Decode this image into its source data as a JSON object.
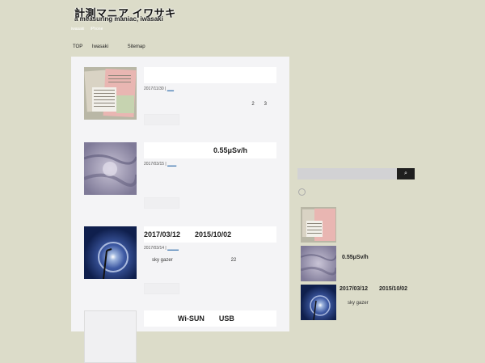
{
  "header": {
    "title": "計測マニア イワサキ",
    "subtitle": "a measuring maniac, iwasaki",
    "breadcrumb": [
      "iwasaki",
      "iPhone"
    ]
  },
  "nav": {
    "items": [
      "TOP",
      "Iwasaki",
      "Sitemap"
    ]
  },
  "posts": [
    {
      "title": "",
      "date": "2017/11/30",
      "meta_link": "___",
      "excerpt": "2　　3"
    },
    {
      "title": "0.55μSv/h",
      "date": "2017/03/15",
      "meta_link": "____",
      "excerpt": ""
    },
    {
      "title": "2017/03/12　　2015/10/02",
      "date": "2017/03/14",
      "meta_link": "_____",
      "excerpt": "sky gazer　　　　　　　　　　　　22"
    },
    {
      "title": "Wi-SUN　　USB",
      "date": "",
      "meta_link": "",
      "excerpt": ""
    }
  ],
  "sidebar": {
    "search_button": "⌕",
    "recent": [
      {
        "title": "",
        "sub": ""
      },
      {
        "title": "0.55μSv/h",
        "sub": ""
      },
      {
        "title": "2017/03/12　　2015/10/02",
        "sub": "sky gazer"
      }
    ]
  },
  "colors": {
    "background": "#dcdcc9",
    "content_bg": "#f4f4f6",
    "link": "#4a7fb5"
  }
}
